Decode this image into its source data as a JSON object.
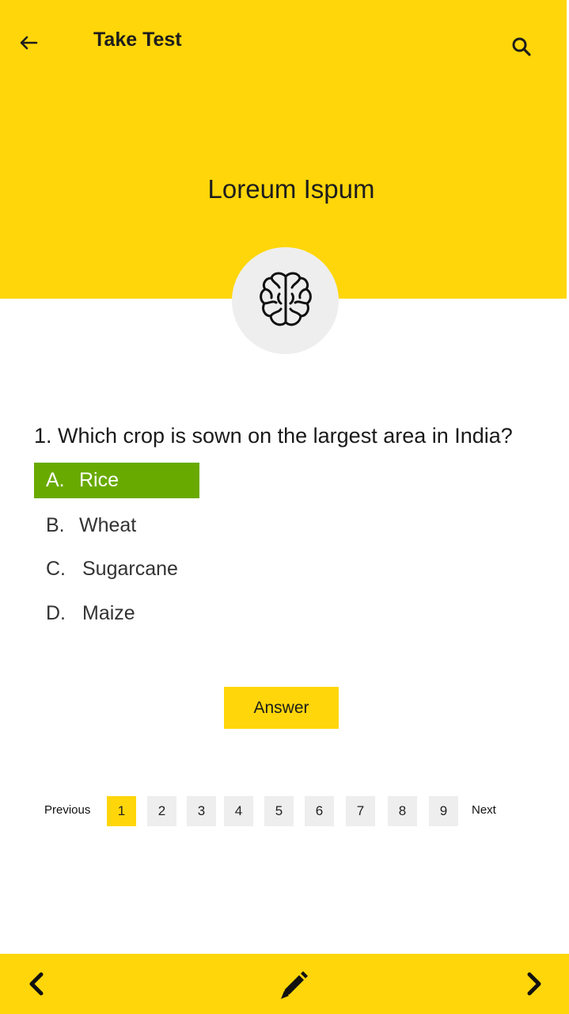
{
  "header": {
    "title": "Take Test",
    "back_icon": "arrow-left-icon",
    "search_icon": "search-icon",
    "background": "#FFD60A"
  },
  "hero": {
    "title": "Loreum Ispum",
    "icon": "brain-icon"
  },
  "quiz": {
    "question": "1. Which crop is sown on the largest area in India?",
    "options": [
      {
        "letter": "A.",
        "text": "Rice",
        "selected": true
      },
      {
        "letter": "B.",
        "text": "Wheat",
        "selected": false
      },
      {
        "letter": "C.",
        "text": "Sugarcane",
        "selected": false
      },
      {
        "letter": "D.",
        "text": "Maize",
        "selected": false
      }
    ],
    "selected_color": "#69AA00",
    "answer_label": "Answer"
  },
  "pagination": {
    "previous_label": "Previous",
    "next_label": "Next",
    "pages": [
      "1",
      "2",
      "3",
      "4",
      "5",
      "6",
      "7",
      "8",
      "9"
    ],
    "current_page": "1"
  },
  "bottom_bar": {
    "left_icon": "chevron-left-icon",
    "center_icon": "pencil-icon",
    "right_icon": "chevron-right-icon"
  }
}
